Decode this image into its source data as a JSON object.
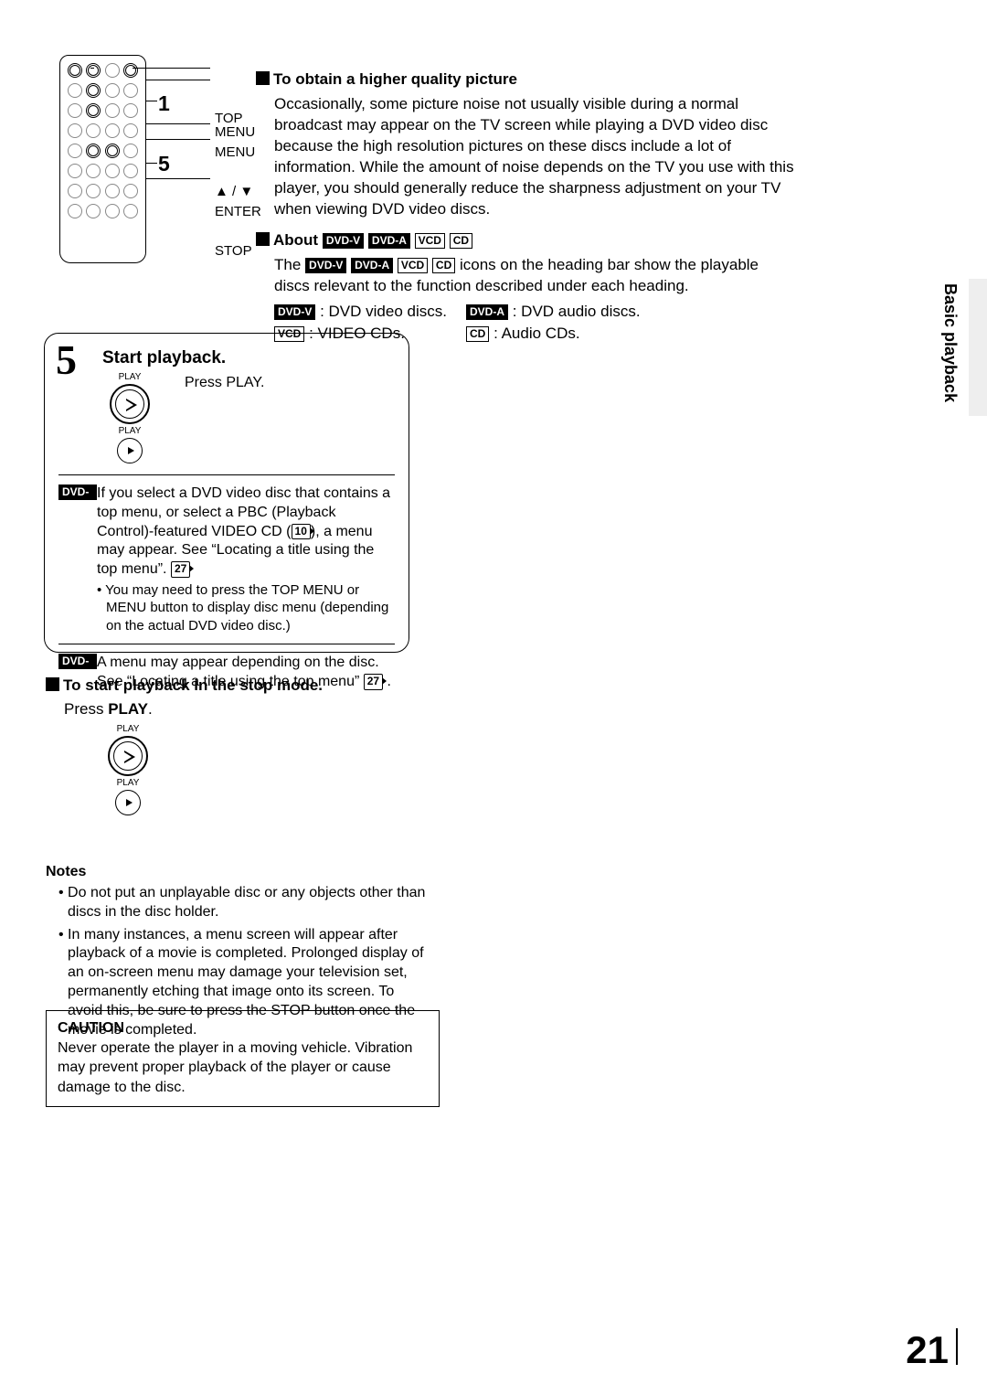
{
  "sideLabel": "Basic playback",
  "pageNumber": "21",
  "remote": {
    "labels": {
      "topmenu": "TOP MENU",
      "menu": "MENU",
      "arrows": "▲ / ▼",
      "enter": "ENTER",
      "stop": "STOP"
    },
    "callouts": {
      "one": "1",
      "five": "5"
    }
  },
  "higherQuality": {
    "heading": "To obtain a higher quality picture",
    "body": "Occasionally, some picture noise not usually visible during a normal broadcast may appear on the TV screen while playing a DVD video disc because the high resolution pictures on these discs include a lot of information. While the amount of noise depends on the TV you use with this player, you should generally reduce the sharpness adjustment on your TV when viewing DVD video discs."
  },
  "about": {
    "heading": "About",
    "tags": {
      "dvdv": "DVD-V",
      "dvda": "DVD-A",
      "vcd": "VCD",
      "cd": "CD"
    },
    "line1a": "The ",
    "line1b": " icons on the heading bar show the playable discs relevant to the function described under each heading.",
    "items": {
      "dvdv": ": DVD video discs.",
      "dvda": ": DVD audio discs.",
      "vcd": ": VIDEO CDs.",
      "cd": ": Audio CDs."
    }
  },
  "step5": {
    "num": "5",
    "title": "Start playback.",
    "playLabelTop": "PLAY",
    "playLabelBottom": "PLAY",
    "press": "Press PLAY.",
    "dvdv": {
      "text": "If you select a DVD video disc that contains a top menu, or select a PBC (Playback Control)-featured VIDEO CD (",
      "ref1": "10",
      "text2": "), a menu may appear. See “Locating a title using the top menu”. ",
      "ref2": "27",
      "bullet": "You may need to press the TOP MENU or MENU button to display disc menu (depending on the actual DVD video disc.)"
    },
    "dvda": {
      "text": "A menu may appear depending on the disc. See “Locating a title using the top menu” ",
      "ref": "27",
      "tail": " ."
    }
  },
  "stopMode": {
    "heading": "To start playback in the stop mode.",
    "press1": "Press ",
    "pressBold": "PLAY",
    "press2": ".",
    "playTop": "PLAY",
    "playBot": "PLAY"
  },
  "notes": {
    "heading": "Notes",
    "items": [
      "Do not put an unplayable disc or any objects other than discs in the disc holder.",
      "In many instances, a menu screen will appear after playback of a movie is completed.  Prolonged display of an on-screen menu may damage your television set, permanently etching that image onto its screen. To avoid this, be sure to press the STOP button once the movie is completed."
    ]
  },
  "caution": {
    "heading": "CAUTION",
    "body": "Never operate the player in a moving vehicle. Vibration may prevent proper playback of the player or cause damage to the disc."
  }
}
